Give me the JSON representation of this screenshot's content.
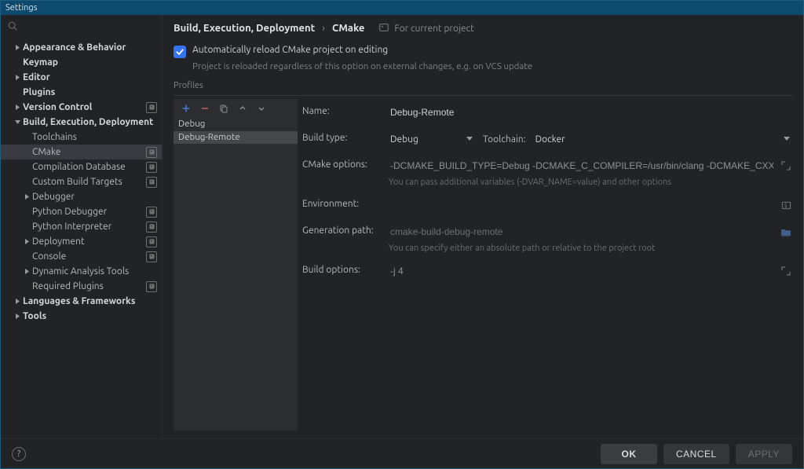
{
  "window": {
    "title": "Settings"
  },
  "search": {
    "placeholder": ""
  },
  "sidebar": [
    {
      "label": "Appearance & Behavior",
      "level": 0,
      "caret": "right",
      "bold": true,
      "badge": false
    },
    {
      "label": "Keymap",
      "level": 0,
      "caret": "none",
      "bold": true,
      "badge": false
    },
    {
      "label": "Editor",
      "level": 0,
      "caret": "right",
      "bold": true,
      "badge": false
    },
    {
      "label": "Plugins",
      "level": 0,
      "caret": "none",
      "bold": true,
      "badge": false
    },
    {
      "label": "Version Control",
      "level": 0,
      "caret": "right",
      "bold": true,
      "badge": true
    },
    {
      "label": "Build, Execution, Deployment",
      "level": 0,
      "caret": "down",
      "bold": true,
      "badge": false
    },
    {
      "label": "Toolchains",
      "level": 1,
      "caret": "none",
      "bold": false,
      "badge": false
    },
    {
      "label": "CMake",
      "level": 1,
      "caret": "none",
      "bold": false,
      "badge": true,
      "selected": true
    },
    {
      "label": "Compilation Database",
      "level": 1,
      "caret": "none",
      "bold": false,
      "badge": true
    },
    {
      "label": "Custom Build Targets",
      "level": 1,
      "caret": "none",
      "bold": false,
      "badge": true
    },
    {
      "label": "Debugger",
      "level": 1,
      "caret": "right",
      "bold": false,
      "badge": false
    },
    {
      "label": "Python Debugger",
      "level": 1,
      "caret": "none",
      "bold": false,
      "badge": true
    },
    {
      "label": "Python Interpreter",
      "level": 1,
      "caret": "none",
      "bold": false,
      "badge": true
    },
    {
      "label": "Deployment",
      "level": 1,
      "caret": "right",
      "bold": false,
      "badge": true
    },
    {
      "label": "Console",
      "level": 1,
      "caret": "none",
      "bold": false,
      "badge": true
    },
    {
      "label": "Dynamic Analysis Tools",
      "level": 1,
      "caret": "right",
      "bold": false,
      "badge": false
    },
    {
      "label": "Required Plugins",
      "level": 1,
      "caret": "none",
      "bold": false,
      "badge": true
    },
    {
      "label": "Languages & Frameworks",
      "level": 0,
      "caret": "right",
      "bold": true,
      "badge": false
    },
    {
      "label": "Tools",
      "level": 0,
      "caret": "right",
      "bold": true,
      "badge": false
    }
  ],
  "breadcrumb": {
    "a": "Build, Execution, Deployment",
    "b": "CMake",
    "scope": "For current project"
  },
  "reload": {
    "label": "Automatically reload CMake project on editing",
    "sub": "Project is reloaded regardless of this option on external changes, e.g. on VCS update"
  },
  "profiles_title": "Profiles",
  "profiles_list": [
    {
      "name": "Debug",
      "selected": false
    },
    {
      "name": "Debug-Remote",
      "selected": true
    }
  ],
  "form": {
    "name_label": "Name:",
    "name_value": "Debug-Remote",
    "buildtype_label": "Build type:",
    "buildtype_value": "Debug",
    "toolchain_label": "Toolchain:",
    "toolchain_value": "Docker",
    "cmakeopts_label": "CMake options:",
    "cmakeopts_value": "-DCMAKE_BUILD_TYPE=Debug -DCMAKE_C_COMPILER=/usr/bin/clang -DCMAKE_CXX_COMPILER=/usr/bin/clan",
    "cmakeopts_hint": "You can pass additional variables (-DVAR_NAME=value) and other options",
    "env_label": "Environment:",
    "env_value": "",
    "genpath_label": "Generation path:",
    "genpath_placeholder": "cmake-build-debug-remote",
    "genpath_hint": "You can specify either an absolute path or relative to the project root",
    "buildopts_label": "Build options:",
    "buildopts_value": "-j 4"
  },
  "buttons": {
    "ok": "OK",
    "cancel": "CANCEL",
    "apply": "APPLY"
  }
}
